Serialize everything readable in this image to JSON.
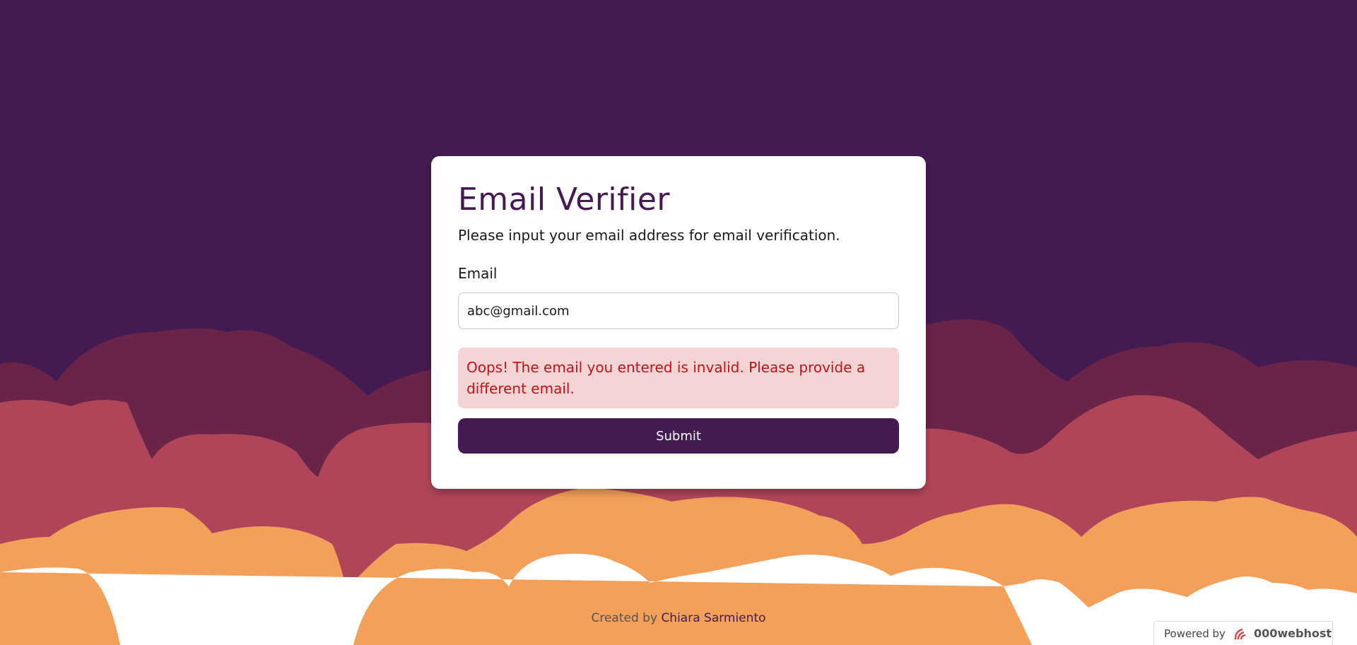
{
  "card": {
    "title": "Email Verifier",
    "subtitle": "Please input your email address for email verification.",
    "email_label": "Email",
    "email_value": "abc@gmail.com",
    "error_message": "Oops! The email you entered is invalid. Please provide a different email.",
    "submit_label": "Submit"
  },
  "footer": {
    "created_by": "Created by",
    "author": "Chiara Sarmiento"
  },
  "badge": {
    "powered_by": "Powered by",
    "brand": "000webhost",
    "brand_icon": "000webhost-logo-icon"
  },
  "colors": {
    "background": "#441a52",
    "accent": "#441a52",
    "error_bg": "#f4d4d4",
    "error_text": "#c2121c",
    "wave_dark": "#6a2448",
    "wave_pink": "#b04559",
    "wave_orange": "#f2a05a",
    "wave_white": "#ffffff"
  }
}
